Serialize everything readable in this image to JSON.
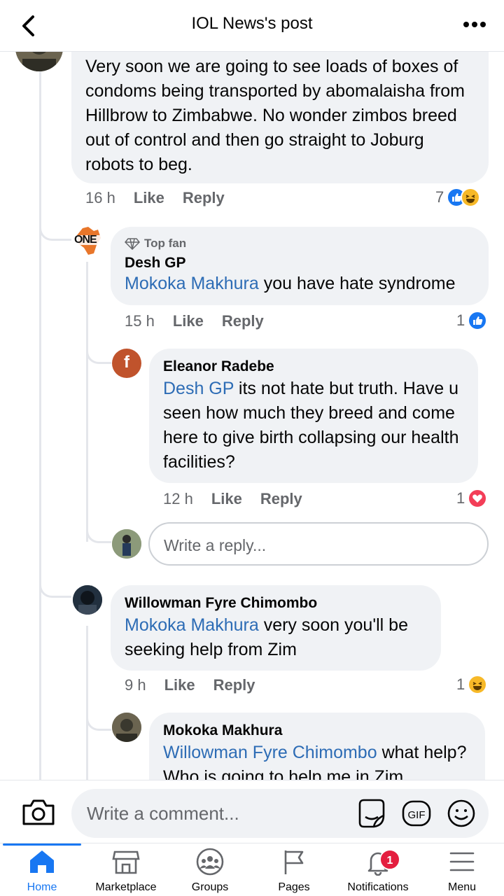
{
  "header": {
    "title": "IOL News's post"
  },
  "comments": [
    {
      "text": "Very soon we are going to see loads of boxes of condoms being transported by abomalaisha from Hillbrow to Zimbabwe. No wonder zimbos breed out of control and then go straight to Joburg robots to beg.",
      "time": "16 h",
      "like": "Like",
      "reply": "Reply",
      "reaction_count": "7"
    },
    {
      "badge": "Top fan",
      "author": "Desh GP",
      "avatar_text": "ONE",
      "mention": "Mokoka Makhura",
      "text": " you have hate syndrome",
      "time": "15 h",
      "like": "Like",
      "reply": "Reply",
      "reaction_count": "1"
    },
    {
      "author": "Eleanor Radebe",
      "avatar_text": "f",
      "mention": "Desh GP",
      "text": " its not hate but truth. Have u seen how much they breed and come here to give birth collapsing our health facilities?",
      "time": "12 h",
      "like": "Like",
      "reply": "Reply",
      "reaction_count": "1"
    },
    {
      "author": "Willowman Fyre Chimombo",
      "mention": "Mokoka Makhura",
      "text": " very soon you'll be seeking help from Zim",
      "time": "9 h",
      "like": "Like",
      "reply": "Reply",
      "reaction_count": "1"
    },
    {
      "author": "Mokoka Makhura",
      "mention": "Willowman Fyre Chimombo",
      "text": " what help? Who is going to help me in Zim"
    }
  ],
  "reply_input": {
    "placeholder": "Write a reply..."
  },
  "composer": {
    "placeholder": "Write a comment..."
  },
  "tabs": [
    {
      "label": "Home",
      "icon": "home-icon",
      "active": true
    },
    {
      "label": "Marketplace",
      "icon": "marketplace-icon"
    },
    {
      "label": "Groups",
      "icon": "groups-icon"
    },
    {
      "label": "Pages",
      "icon": "pages-icon"
    },
    {
      "label": "Notifications",
      "icon": "bell-icon",
      "badge": "1"
    },
    {
      "label": "Menu",
      "icon": "menu-icon"
    }
  ],
  "colors": {
    "accent": "#1877f2",
    "mention": "#2d6cb5",
    "bubble": "#f0f2f5",
    "badge": "#e41e3f"
  }
}
